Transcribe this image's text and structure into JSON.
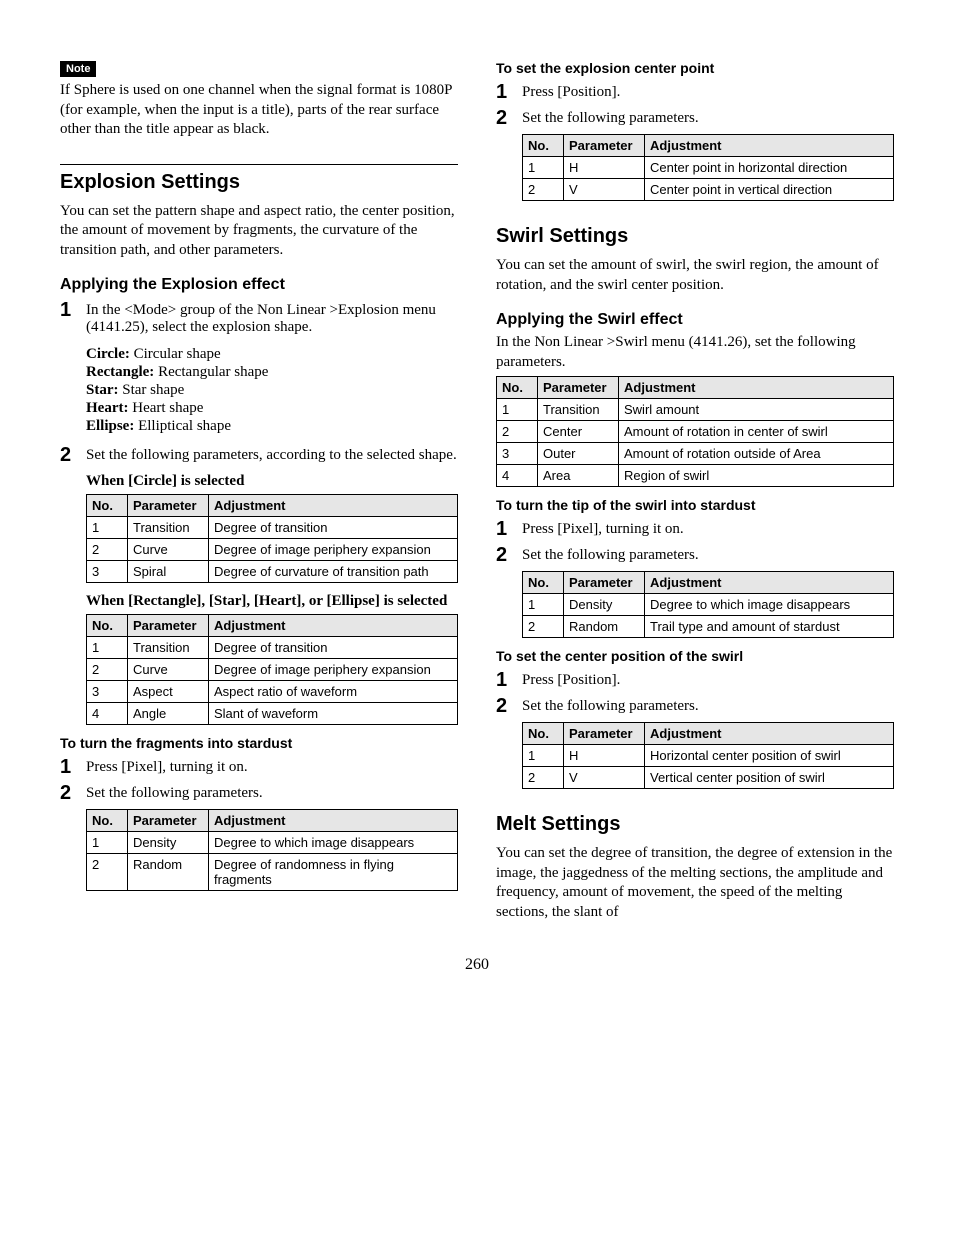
{
  "pageNumber": "260",
  "left": {
    "noteBadge": "Note",
    "noteText": "If Sphere is used on one channel when the signal format is 1080P (for example, when the input is a title), parts of the rear surface other than the title appear as black.",
    "h2_explosion": "Explosion Settings",
    "explosionIntro": "You can set the pattern shape and aspect ratio, the center position, the amount of movement by fragments, the curvature of the transition path, and other parameters.",
    "h3_applyExplosion": "Applying the Explosion effect",
    "step1": "In the <Mode> group of the Non Linear >Explosion menu (4141.25), select the explosion shape.",
    "shapes": {
      "circle_k": "Circle:",
      "circle_v": " Circular shape",
      "rect_k": "Rectangle:",
      "rect_v": " Rectangular shape",
      "star_k": "Star:",
      "star_v": " Star shape",
      "heart_k": "Heart:",
      "heart_v": " Heart shape",
      "ellipse_k": "Ellipse:",
      "ellipse_v": " Elliptical shape"
    },
    "step2": "Set the following parameters, according to the selected shape.",
    "cap_circle": "When [Circle] is selected",
    "th_no": "No.",
    "th_param": "Parameter",
    "th_adj": "Adjustment",
    "tblCircle": {
      "r1c1": "1",
      "r1c2": "Transition",
      "r1c3": "Degree of transition",
      "r2c1": "2",
      "r2c2": "Curve",
      "r2c3": "Degree of image periphery expansion",
      "r3c1": "3",
      "r3c2": "Spiral",
      "r3c3": "Degree of curvature of transition path"
    },
    "cap_rect": "When [Rectangle], [Star], [Heart], or [Ellipse] is selected",
    "tblRect": {
      "r1c1": "1",
      "r1c2": "Transition",
      "r1c3": "Degree of transition",
      "r2c1": "2",
      "r2c2": "Curve",
      "r2c3": "Degree of image periphery expansion",
      "r3c1": "3",
      "r3c2": "Aspect",
      "r3c3": "Aspect ratio of waveform",
      "r4c1": "4",
      "r4c2": "Angle",
      "r4c3": "Slant of waveform"
    },
    "h4_fragStardust": "To turn the fragments into stardust",
    "frag_step1": "Press [Pixel], turning it on.",
    "frag_step2": "Set the following parameters.",
    "tblFrag": {
      "r1c1": "1",
      "r1c2": "Density",
      "r1c3": "Degree to which image disappears",
      "r2c1": "2",
      "r2c2": "Random",
      "r2c3": "Degree of randomness in flying fragments"
    }
  },
  "right": {
    "h4_expCenter": "To set the explosion center point",
    "expCenter_step1": "Press [Position].",
    "expCenter_step2": "Set the following parameters.",
    "tblExpCenter": {
      "r1c1": "1",
      "r1c2": "H",
      "r1c3": "Center point in horizontal direction",
      "r2c1": "2",
      "r2c2": "V",
      "r2c3": "Center point in vertical direction"
    },
    "h2_swirl": "Swirl Settings",
    "swirlIntro": "You can set the amount of swirl, the swirl region, the amount of rotation, and the swirl center position.",
    "h3_applySwirl": "Applying the Swirl effect",
    "swirlMenu": "In the Non Linear >Swirl menu (4141.26), set the following parameters.",
    "tblSwirl": {
      "r1c1": "1",
      "r1c2": "Transition",
      "r1c3": "Swirl amount",
      "r2c1": "2",
      "r2c2": "Center",
      "r2c3": "Amount of rotation in center of swirl",
      "r3c1": "3",
      "r3c2": "Outer",
      "r3c3": "Amount of rotation outside of Area",
      "r4c1": "4",
      "r4c2": "Area",
      "r4c3": "Region of swirl"
    },
    "h4_swirlStardust": "To turn the tip of the swirl into stardust",
    "swirlStar_step1": "Press [Pixel], turning it on.",
    "swirlStar_step2": "Set the following parameters.",
    "tblSwirlStar": {
      "r1c1": "1",
      "r1c2": "Density",
      "r1c3": "Degree to which image disappears",
      "r2c1": "2",
      "r2c2": "Random",
      "r2c3": "Trail type and amount of stardust"
    },
    "h4_swirlCenter": "To set the center position of the swirl",
    "swirlCenter_step1": "Press [Position].",
    "swirlCenter_step2": "Set the following parameters.",
    "tblSwirlCenter": {
      "r1c1": "1",
      "r1c2": "H",
      "r1c3": "Horizontal center position of swirl",
      "r2c1": "2",
      "r2c2": "V",
      "r2c3": "Vertical center position of swirl"
    },
    "h2_melt": "Melt Settings",
    "meltIntro": "You can set the degree of transition, the degree of extension in the image, the jaggedness of the melting sections, the amplitude and frequency, amount of movement, the speed of the melting sections, the slant of"
  }
}
